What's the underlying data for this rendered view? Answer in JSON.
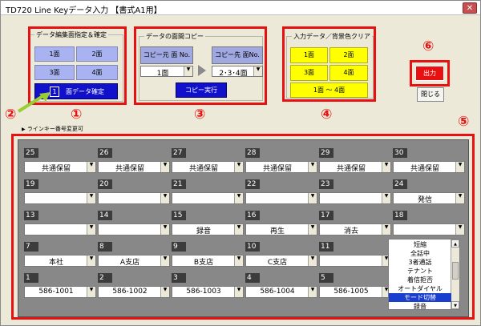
{
  "window": {
    "title": "TD720  Line Keyデータ入力 【書式A1用】",
    "close_label": "✕"
  },
  "marks": [
    "①",
    "②",
    "③",
    "④",
    "⑤",
    "⑥"
  ],
  "edit_group": {
    "title": "データ編集面指定＆確定",
    "buttons": [
      "1面",
      "2面",
      "3面",
      "4面"
    ],
    "current_face": "1",
    "confirm_label": "面データ確定"
  },
  "copy_group": {
    "title": "データの面間コピー",
    "source_label": "コピー元 面 No.",
    "target_label": "コピー先 面No.",
    "source_value": "1面",
    "target_value": "2･3･4面",
    "execute_label": "コピー実行"
  },
  "clear_group": {
    "title": "入力データ／背景色クリア",
    "buttons": [
      "1面",
      "2面",
      "3面",
      "4面"
    ],
    "all_label": "1面 ～ 4面"
  },
  "actions": {
    "output_label": "出力",
    "close_label": "閉じる"
  },
  "editable_label": "ラインキー番号変更可",
  "grid": {
    "rows": [
      [
        {
          "num": "25",
          "value": "共通保留"
        },
        {
          "num": "26",
          "value": "共通保留"
        },
        {
          "num": "27",
          "value": "共通保留"
        },
        {
          "num": "28",
          "value": "共通保留"
        },
        {
          "num": "29",
          "value": "共通保留"
        },
        {
          "num": "30",
          "value": "共通保留"
        }
      ],
      [
        {
          "num": "19",
          "value": ""
        },
        {
          "num": "20",
          "value": ""
        },
        {
          "num": "21",
          "value": ""
        },
        {
          "num": "22",
          "value": ""
        },
        {
          "num": "23",
          "value": ""
        },
        {
          "num": "24",
          "value": "発信"
        }
      ],
      [
        {
          "num": "13",
          "value": ""
        },
        {
          "num": "14",
          "value": ""
        },
        {
          "num": "15",
          "value": "録音"
        },
        {
          "num": "16",
          "value": "再生"
        },
        {
          "num": "17",
          "value": "消去"
        },
        {
          "num": "18",
          "value": ""
        }
      ],
      [
        {
          "num": "7",
          "value": "本社"
        },
        {
          "num": "8",
          "value": "A支店"
        },
        {
          "num": "9",
          "value": "B支店"
        },
        {
          "num": "10",
          "value": "C支店"
        },
        {
          "num": "11",
          "value": ""
        }
      ],
      [
        {
          "num": "1",
          "value": "586-1001"
        },
        {
          "num": "2",
          "value": "586-1002"
        },
        {
          "num": "3",
          "value": "586-1003"
        },
        {
          "num": "4",
          "value": "586-1004"
        },
        {
          "num": "5",
          "value": "586-1005"
        }
      ]
    ],
    "open_dropdown_options": [
      "短縮",
      "全話中",
      "3者通話",
      "テナント",
      "着信拒否",
      "オートダイヤル",
      "モード切替",
      "録音"
    ],
    "open_dropdown_selected": "モード切替"
  },
  "colors": {
    "highlight_red": "#e81010",
    "face_button": "#a9b3f2",
    "clear_button": "#ffff00",
    "confirm_button": "#1111cc",
    "grid_background": "#888888"
  }
}
